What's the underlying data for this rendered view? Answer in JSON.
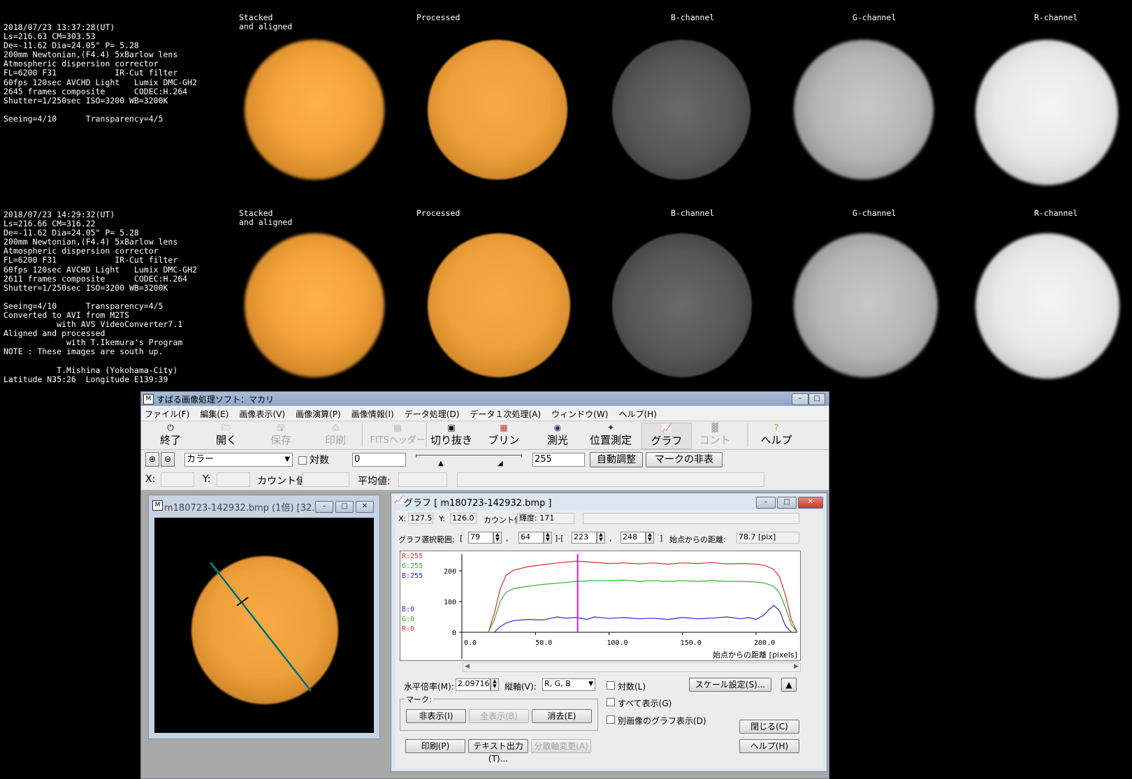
{
  "observations": [
    {
      "lines": [
        "2018/07/23 13:37:28(UT)",
        "Ls=216.63 CM=303.53",
        "De=-11.62 Dia=24.05\" P= 5.28",
        "200mm Newtonian,(F4.4) 5xBarlow lens",
        "Atmospheric dispersion corrector",
        "FL=6200 F31            IR-Cut filter",
        "60fps 120sec AVCHD Light   Lumix DMC-GH2",
        "2645 frames composite      CODEC:H.264",
        "Shutter=1/250sec ISO=3200 WB=3200K",
        "",
        "Seeing=4/10      Transparency=4/5"
      ]
    },
    {
      "lines": [
        "2018/07/23 14:29:32(UT)",
        "Ls=216.66 CM=316.22",
        "De=-11.62 Dia=24.05\" P= 5.28",
        "200mm Newtonian,(F4.4) 5xBarlow lens",
        "Atmospheric dispersion corrector",
        "FL=6200 F31            IR-Cut filter",
        "60fps 120sec AVCHD Light   Lumix DMC-GH2",
        "2611 frames composite      CODEC:H.264",
        "Shutter=1/250sec ISO=3200 WB=3200K",
        "",
        "Seeing=4/10      Transparency=4/5",
        "Converted to AVI from M2TS",
        "           with AVS VideoConverter7.1",
        "Aligned and processed",
        "             with T.Ikemura's Program",
        "NOTE : These images are south up.",
        "",
        "           T.Mishina (Yokohama-City)",
        "Latitude N35:26  Longitude E139:39"
      ]
    }
  ],
  "panel_labels": {
    "stacked": "Stacked\nand aligned",
    "processed": "Processed",
    "b": "B-channel",
    "g": "G-channel",
    "r": "R-channel"
  },
  "app": {
    "title": "すばる画像処理ソフト：マカリ",
    "menu": [
      "ファイル(F)",
      "編集(E)",
      "画像表示(V)",
      "画像演算(P)",
      "画像情報(I)",
      "データ処理(D)",
      "データ１次処理(A)",
      "ウィンドウ(W)",
      "ヘルプ(H)"
    ],
    "toolbar": {
      "exit": "終了",
      "open": "開く",
      "save": "保存",
      "print": "印刷",
      "fits": "FITSヘッダー",
      "crop": "切り抜き",
      "blink": "ブリンク",
      "photometry": "測光",
      "astrometry": "位置測定",
      "graph": "グラフ",
      "contour": "コントア",
      "help": "ヘルプ"
    },
    "display": {
      "mode": "カラー",
      "log_label": "対数",
      "min": "0",
      "max": "255",
      "auto_button": "自動調整",
      "hide_marks_button": "マークの非表示..."
    },
    "status": {
      "x_label": "X:",
      "y_label": "Y:",
      "count_label": "カウント値:",
      "avg_label": "平均値:"
    }
  },
  "image_window": {
    "title": "m180723-142932.bmp (1倍) [32..."
  },
  "graph_window": {
    "title": "グラフ [ m180723-142932.bmp ]",
    "x_label": "X:",
    "x_value": "127.5",
    "y_label": "Y:",
    "y_value": "126.0",
    "count_label": "カウント値:",
    "count_value": "輝度: 171",
    "range_label": "グラフ選択範囲:",
    "range": [
      "79",
      "64",
      "223",
      "248"
    ],
    "dist_label": "始点からの距離:",
    "dist_value": "78.7 [pix]",
    "zoom_label": "水平倍率(M):",
    "zoom_value": "2.09716",
    "axis_label": "縦軸(V):",
    "axis_value": "R, G, B",
    "log_label": "対数(L)",
    "scale_button": "スケール設定(S)...",
    "show_all_check": "すべて表示(G)",
    "other_image_check": "別画像のグラフ表示(D)",
    "marks_group": "マーク:",
    "hide_button": "非表示(I)",
    "show_all_button": "全表示(B)",
    "delete_button": "消去(E)",
    "close_button": "閉じる(C)",
    "print_button": "印刷(P)",
    "text_out_button": "テキスト出力(T)...",
    "scatter_button": "分散軸変更(A)",
    "help_button": "ヘルプ(H)"
  },
  "chart_data": {
    "type": "line",
    "xlabel": "始点からの距離 [pixels]",
    "xlim": [
      0,
      228
    ],
    "ylim": [
      0,
      255
    ],
    "x_ticks": [
      "0.0",
      "50.0",
      "100.0",
      "150.0",
      "200.0"
    ],
    "y_ticks": [
      "200",
      "100",
      "0"
    ],
    "legend_top": [
      "R:255",
      "G:255",
      "B:255"
    ],
    "legend_bottom": [
      "B:0",
      "G:0",
      "R:0"
    ],
    "cursor_x": 78.7,
    "colors": {
      "R": "#d83030",
      "G": "#30b030",
      "B": "#2a2ad0",
      "cursor": "#d020d0"
    },
    "series": [
      {
        "name": "R",
        "x": [
          18,
          22,
          26,
          30,
          35,
          45,
          55,
          65,
          78,
          90,
          100,
          110,
          120,
          130,
          140,
          150,
          160,
          170,
          180,
          190,
          200,
          206,
          212,
          216,
          220,
          224,
          228
        ],
        "y": [
          0,
          60,
          140,
          185,
          202,
          214,
          220,
          226,
          232,
          228,
          224,
          226,
          223,
          226,
          222,
          226,
          224,
          227,
          223,
          224,
          222,
          218,
          205,
          180,
          120,
          40,
          0
        ]
      },
      {
        "name": "G",
        "x": [
          18,
          22,
          26,
          30,
          35,
          45,
          55,
          65,
          78,
          90,
          100,
          110,
          120,
          130,
          140,
          150,
          160,
          170,
          180,
          190,
          200,
          206,
          212,
          216,
          220,
          224,
          228
        ],
        "y": [
          0,
          40,
          100,
          130,
          142,
          150,
          156,
          160,
          166,
          168,
          168,
          170,
          166,
          168,
          166,
          168,
          166,
          168,
          166,
          166,
          164,
          160,
          150,
          128,
          80,
          25,
          0
        ]
      },
      {
        "name": "B",
        "x": [
          22,
          26,
          30,
          35,
          45,
          55,
          65,
          70,
          78,
          85,
          90,
          100,
          110,
          120,
          130,
          140,
          150,
          160,
          170,
          180,
          190,
          195,
          200,
          205,
          208,
          212,
          216,
          220,
          224
        ],
        "y": [
          0,
          18,
          30,
          38,
          42,
          40,
          50,
          46,
          48,
          42,
          50,
          45,
          48,
          44,
          46,
          42,
          48,
          44,
          46,
          50,
          44,
          48,
          42,
          55,
          70,
          88,
          70,
          20,
          0
        ]
      }
    ]
  }
}
